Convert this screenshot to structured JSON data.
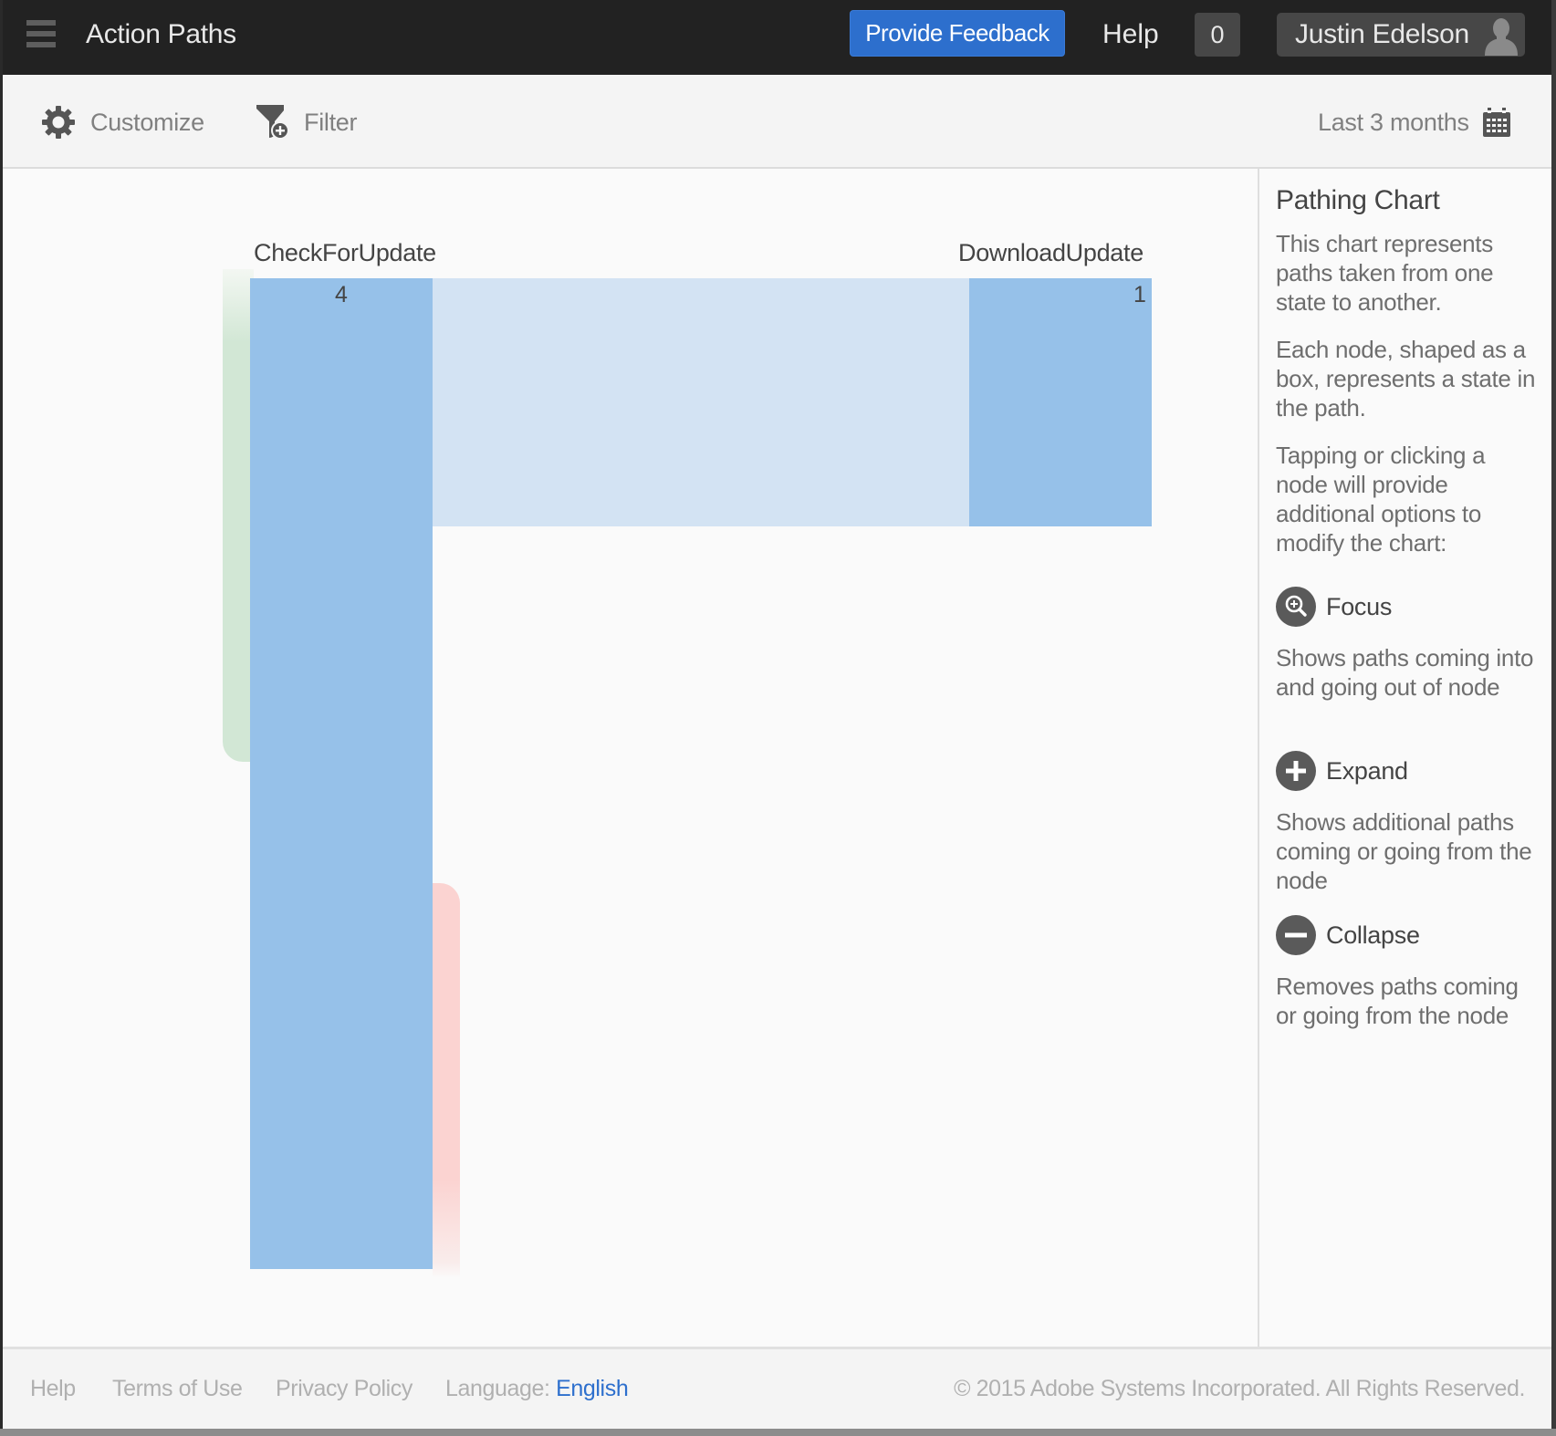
{
  "header": {
    "app_title": "Action Paths",
    "feedback_label": "Provide Feedback",
    "help_label": "Help",
    "notification_count": "0",
    "user_name": "Justin Edelson",
    "feedback_color": "#2d6fcd"
  },
  "toolbar": {
    "customize_label": "Customize",
    "customize_icon": "gear-icon",
    "filter_label": "Filter",
    "filter_icon": "filter-add-icon",
    "date_range_label": "Last 3 months",
    "date_range_icon": "calendar-icon"
  },
  "chart_data": {
    "type": "pathing",
    "title": "",
    "nodes": [
      {
        "id": "CheckForUpdate",
        "label": "CheckForUpdate",
        "value": 4,
        "column": 0
      },
      {
        "id": "DownloadUpdate",
        "label": "DownloadUpdate",
        "value": 1,
        "column": 1
      }
    ],
    "links": [
      {
        "source": "CheckForUpdate",
        "target": "DownloadUpdate",
        "value": 1
      }
    ],
    "entries": [
      {
        "target": "CheckForUpdate",
        "value": 2,
        "kind": "entry",
        "color": "#d2e7d5"
      }
    ],
    "exits": [
      {
        "source": "CheckForUpdate",
        "value": 2,
        "kind": "exit",
        "color": "#fbd3d1"
      }
    ],
    "colors": {
      "node": "#96c1e9",
      "link": "#d3e3f3",
      "entry": "#d2e7d5",
      "exit": "#fbd3d1"
    },
    "labels": {
      "n0_label": "CheckForUpdate",
      "n0_value": "4",
      "n1_label": "DownloadUpdate",
      "n1_value": "1"
    }
  },
  "sidebar": {
    "title": "Pathing Chart",
    "intro": [
      "This chart represents paths taken from one state to another.",
      "Each node, shaped as a box, represents a state in the path.",
      "Tapping or clicking a node will provide additional options to modify the chart:"
    ],
    "actions": [
      {
        "label": "Focus",
        "icon": "focus-zoom-icon",
        "description": "Shows paths coming into and going out of node"
      },
      {
        "label": "Expand",
        "icon": "expand-plus-icon",
        "description": "Shows additional paths coming or going from the node"
      },
      {
        "label": "Collapse",
        "icon": "collapse-minus-icon",
        "description": "Removes paths coming or going from the node"
      }
    ]
  },
  "footer": {
    "links": [
      "Help",
      "Terms of Use",
      "Privacy Policy"
    ],
    "language_label": "Language:",
    "language_value": "English",
    "copyright": "© 2015 Adobe Systems Incorporated. All Rights Reserved."
  }
}
